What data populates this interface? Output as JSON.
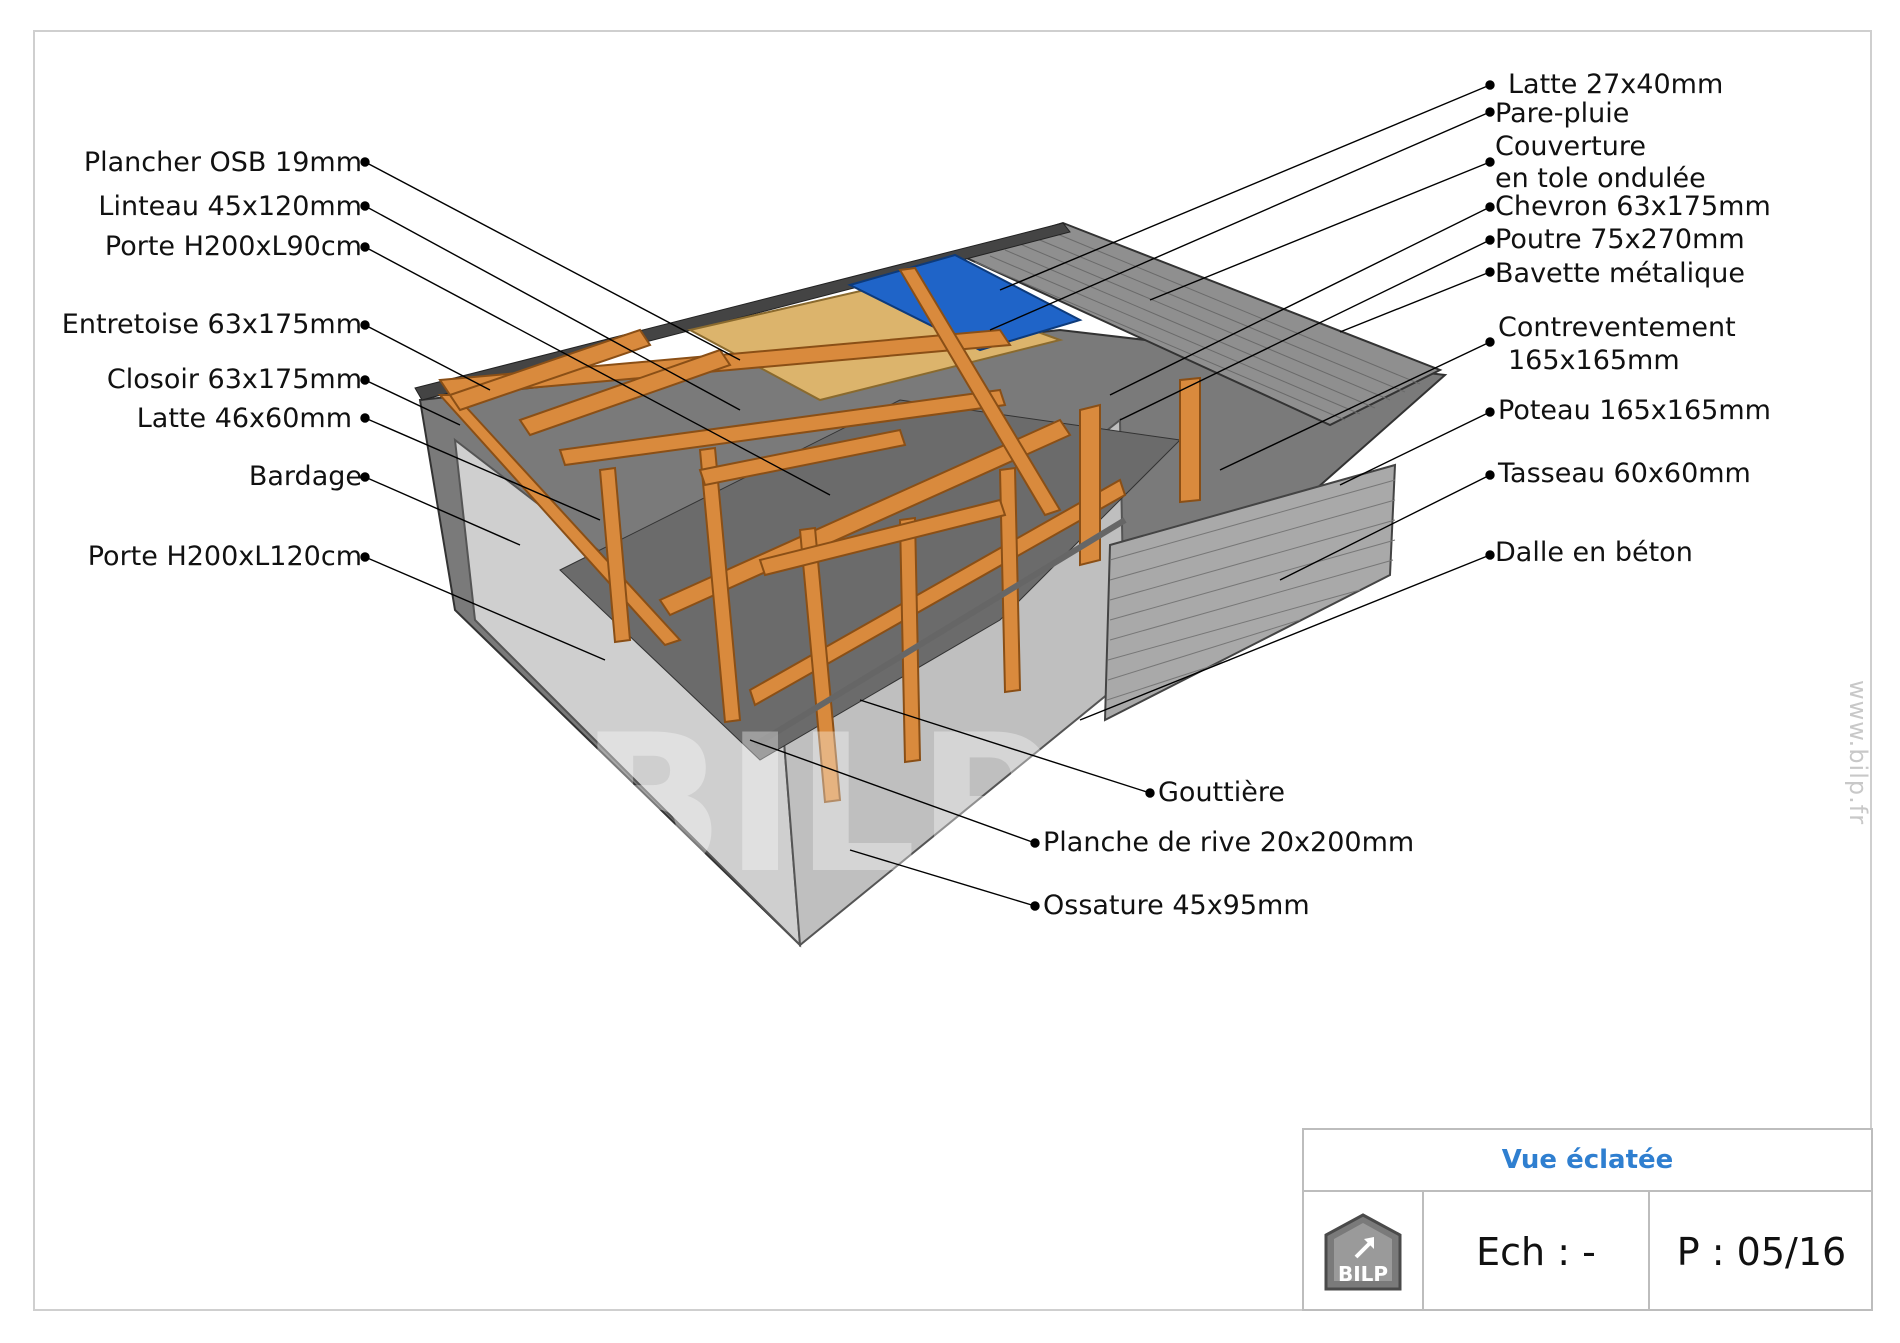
{
  "labels": {
    "left": [
      "Plancher OSB 19mm",
      "Linteau 45x120mm",
      "Porte H200xL90cm",
      "Entretoise 63x175mm",
      "Closoir 63x175mm",
      "Latte 46x60mm",
      "Bardage",
      "Porte H200xL120cm"
    ],
    "right": [
      "Latte 27x40mm",
      "Pare-pluie",
      "Couverture",
      "en tole ondulée",
      "Chevron 63x175mm",
      "Poutre 75x270mm",
      "Bavette métalique",
      "Contreventement",
      "165x165mm",
      "Poteau 165x165mm",
      "Tasseau 60x60mm",
      "Dalle en béton"
    ],
    "bottom": [
      "Gouttière",
      "Planche de rive 20x200mm",
      "Ossature 45x95mm"
    ]
  },
  "watermark_side": "www.bilp.fr",
  "title_block": {
    "title": "Vue éclatée",
    "logo_text": "BILP",
    "scale": "Ech : -",
    "page": "P : 05/16"
  },
  "colors": {
    "timber": "#d98a3d",
    "timber_dark": "#a9621f",
    "osb": "#dcb46c",
    "membrane": "#1f64c8",
    "roof_sheet": "#8c8c8c",
    "cladding": "#c9c9c9",
    "slab": "#6e6e6e",
    "title_blue": "#2f7fd0"
  }
}
